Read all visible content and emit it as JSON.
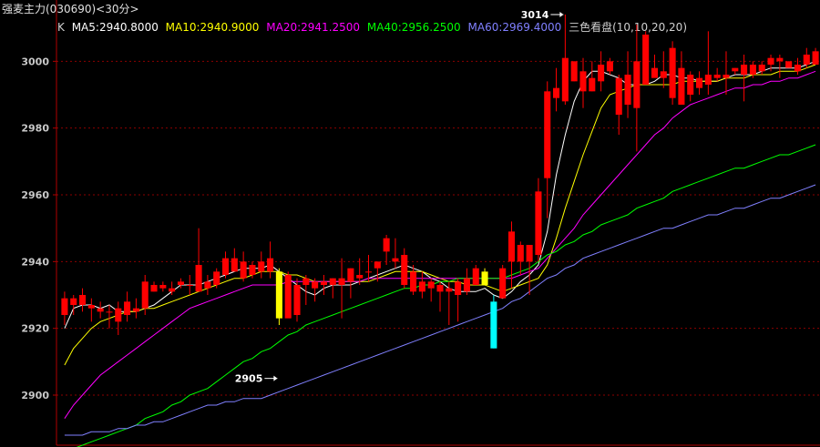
{
  "header": {
    "title": "强麦主力(030690)<30分>"
  },
  "legend": {
    "k_label": "K",
    "items": [
      {
        "text": "MA5:2940.8000",
        "color": "#ffffff"
      },
      {
        "text": "MA10:2940.9000",
        "color": "#ffff00"
      },
      {
        "text": "MA20:2941.2500",
        "color": "#ff00ff"
      },
      {
        "text": "MA40:2956.2500",
        "color": "#00ff00"
      },
      {
        "text": "MA60:2969.4000",
        "color": "#8080ff"
      },
      {
        "text": "三色看盘(10,10,20,20)",
        "color": "#d0d0d0"
      }
    ]
  },
  "colors": {
    "up": "#ff0000",
    "down_wick": "#ff0000",
    "highlight_yellow": "#ffff00",
    "highlight_cyan": "#00ffff",
    "grid": "#8b0000",
    "axis": "#b00000"
  },
  "chart_data": {
    "type": "candlestick",
    "ylim": [
      2885,
      3008
    ],
    "yticks": [
      2900,
      2920,
      2940,
      2960,
      2980,
      3000
    ],
    "candles": [
      [
        2924,
        2929,
        2921,
        2931,
        "up"
      ],
      [
        2927,
        2929,
        2924,
        2930,
        "up"
      ],
      [
        2927,
        2930,
        2925,
        2932,
        "up"
      ],
      [
        2927,
        2926,
        2922,
        2929,
        "up"
      ],
      [
        2926,
        2925,
        2923,
        2928,
        "up"
      ],
      [
        2925,
        2925,
        2920,
        2927,
        "up"
      ],
      [
        2922,
        2926,
        2918,
        2928,
        "up"
      ],
      [
        2924,
        2928,
        2922,
        2931,
        "up"
      ],
      [
        2925,
        2926,
        2923,
        2929,
        "up"
      ],
      [
        2926,
        2934,
        2924,
        2936,
        "up"
      ],
      [
        2931,
        2933,
        2931,
        2934,
        "up"
      ],
      [
        2932,
        2933,
        2931,
        2934,
        "up"
      ],
      [
        2932,
        2931,
        2930,
        2934,
        "up"
      ],
      [
        2933,
        2934,
        2932,
        2935,
        "up"
      ],
      [
        2933,
        2933,
        2930,
        2936,
        "up"
      ],
      [
        2931,
        2939,
        2931,
        2950,
        "up"
      ],
      [
        2932,
        2934,
        2930,
        2936,
        "up"
      ],
      [
        2933,
        2937,
        2932,
        2938,
        "up"
      ],
      [
        2936,
        2941,
        2935,
        2943,
        "up"
      ],
      [
        2937,
        2941,
        2937,
        2944,
        "up"
      ],
      [
        2935,
        2940,
        2934,
        2943,
        "up"
      ],
      [
        2936,
        2939,
        2935,
        2940,
        "up"
      ],
      [
        2937,
        2940,
        2935,
        2943,
        "up"
      ],
      [
        2937,
        2941,
        2935,
        2946,
        "up"
      ],
      [
        2923,
        2937,
        2921,
        2938,
        "yellow"
      ],
      [
        2923,
        2936,
        2924,
        2937,
        "up"
      ],
      [
        2924,
        2933,
        2922,
        2935,
        "up"
      ],
      [
        2933,
        2935,
        2927,
        2936,
        "up"
      ],
      [
        2932,
        2934,
        2928,
        2935,
        "up"
      ],
      [
        2933,
        2934,
        2930,
        2936,
        "up"
      ],
      [
        2933,
        2935,
        2929,
        2935,
        "up"
      ],
      [
        2933,
        2935,
        2923,
        2941,
        "up"
      ],
      [
        2934,
        2938,
        2929,
        2938,
        "up"
      ],
      [
        2935,
        2936,
        2933,
        2941,
        "up"
      ],
      [
        2937,
        2937,
        2934,
        2942,
        "up"
      ],
      [
        2938,
        2940,
        2934,
        2940,
        "up"
      ],
      [
        2943,
        2947,
        2939,
        2948,
        "up"
      ],
      [
        2940,
        2941,
        2938,
        2947,
        "up"
      ],
      [
        2933,
        2942,
        2932,
        2944,
        "up"
      ],
      [
        2931,
        2937,
        2930,
        2939,
        "up"
      ],
      [
        2931,
        2934,
        2929,
        2937,
        "up"
      ],
      [
        2932,
        2934,
        2928,
        2935,
        "up"
      ],
      [
        2931,
        2933,
        2925,
        2934,
        "up"
      ],
      [
        2931,
        2932,
        2921,
        2934,
        "up"
      ],
      [
        2930,
        2934,
        2922,
        2935,
        "up"
      ],
      [
        2931,
        2935,
        2930,
        2938,
        "up"
      ],
      [
        2933,
        2938,
        2934,
        2939,
        "up"
      ],
      [
        2933,
        2937,
        2933,
        2938,
        "yellow"
      ],
      [
        2914,
        2928,
        2914,
        2930,
        "cyan"
      ],
      [
        2929,
        2938,
        2929,
        2939,
        "up"
      ],
      [
        2940,
        2949,
        2932,
        2952,
        "up"
      ],
      [
        2940,
        2945,
        2936,
        2946,
        "up"
      ],
      [
        2940,
        2945,
        2930,
        2945,
        "up"
      ],
      [
        2942,
        2961,
        2940,
        2965,
        "up"
      ],
      [
        2965,
        2991,
        2953,
        2994,
        "up"
      ],
      [
        2989,
        2992,
        2985,
        2998,
        "up"
      ],
      [
        2988,
        3001,
        2987,
        3014,
        "up"
      ],
      [
        2994,
        3000,
        2994,
        3000,
        "up"
      ],
      [
        2991,
        2997,
        2986,
        3001,
        "up"
      ],
      [
        2991,
        2995,
        2991,
        3000,
        "up"
      ],
      [
        2994,
        2999,
        2991,
        3003,
        "up"
      ],
      [
        2997,
        3000,
        2996,
        3001,
        "up"
      ],
      [
        2984,
        2995,
        2978,
        2996,
        "up"
      ],
      [
        2987,
        2996,
        2983,
        3003,
        "up"
      ],
      [
        2986,
        3000,
        2973,
        3011,
        "up"
      ],
      [
        2993,
        3008,
        2993,
        3009,
        "up"
      ],
      [
        2995,
        2998,
        2996,
        3002,
        "up"
      ],
      [
        2995,
        2997,
        2992,
        3003,
        "up"
      ],
      [
        2989,
        3004,
        2987,
        3006,
        "up"
      ],
      [
        2987,
        2998,
        2988,
        3003,
        "up"
      ],
      [
        2990,
        2996,
        2988,
        2997,
        "up"
      ],
      [
        2992,
        2995,
        2990,
        2997,
        "up"
      ],
      [
        2993,
        2996,
        2990,
        3009,
        "up"
      ],
      [
        2995,
        2996,
        2994,
        2998,
        "up"
      ],
      [
        2995,
        2996,
        2990,
        3003,
        "up"
      ],
      [
        2997,
        2998,
        2996,
        2998,
        "up"
      ],
      [
        2996,
        2999,
        2988,
        3002,
        "up"
      ],
      [
        2996,
        2999,
        2995,
        3000,
        "up"
      ],
      [
        2997,
        2999,
        2996,
        3000,
        "up"
      ],
      [
        2999,
        3001,
        2997,
        3002,
        "up"
      ],
      [
        3000,
        3001,
        2995,
        3002,
        "up"
      ],
      [
        2998,
        3000,
        2999,
        3000,
        "up"
      ],
      [
        2997,
        2999,
        2996,
        3001,
        "up"
      ],
      [
        2999,
        3002,
        2998,
        3004,
        "up"
      ],
      [
        2999,
        3003,
        2999,
        3004,
        "up"
      ]
    ],
    "ma_lines": [
      {
        "name": "MA5",
        "color": "#ffffff",
        "values": [
          2920,
          2926,
          2927,
          2927,
          2926,
          2927,
          2925,
          2925,
          2925,
          2926,
          2927,
          2929,
          2931,
          2933,
          2933,
          2933,
          2934,
          2935,
          2936,
          2937,
          2938,
          2938,
          2938,
          2939,
          2937,
          2935,
          2933,
          2931,
          2930,
          2932,
          2933,
          2933,
          2933,
          2934,
          2935,
          2936,
          2937,
          2938,
          2939,
          2938,
          2937,
          2935,
          2934,
          2932,
          2931,
          2931,
          2931,
          2932,
          2930,
          2929,
          2931,
          2934,
          2936,
          2939,
          2949,
          2966,
          2978,
          2988,
          2994,
          2997,
          2997,
          2996,
          2995,
          2993,
          2993,
          2993,
          2994,
          2996,
          2996,
          2995,
          2995,
          2994,
          2994,
          2994,
          2995,
          2996,
          2996,
          2996,
          2997,
          2998,
          2998,
          2998,
          2998,
          2999,
          3000
        ]
      },
      {
        "name": "MA10",
        "color": "#ffff00",
        "values": [
          2909,
          2914,
          2917,
          2920,
          2922,
          2923,
          2924,
          2925,
          2925,
          2926,
          2926,
          2927,
          2928,
          2929,
          2930,
          2931,
          2932,
          2933,
          2934,
          2935,
          2935,
          2936,
          2937,
          2937,
          2937,
          2936,
          2936,
          2935,
          2934,
          2934,
          2934,
          2934,
          2934,
          2934,
          2934,
          2935,
          2936,
          2937,
          2937,
          2937,
          2937,
          2936,
          2935,
          2934,
          2934,
          2933,
          2933,
          2933,
          2932,
          2931,
          2932,
          2933,
          2934,
          2935,
          2939,
          2947,
          2956,
          2964,
          2972,
          2979,
          2986,
          2990,
          2991,
          2992,
          2993,
          2993,
          2993,
          2993,
          2993,
          2994,
          2994,
          2994,
          2994,
          2994,
          2995,
          2995,
          2995,
          2996,
          2996,
          2996,
          2997,
          2997,
          2997,
          2998,
          2999
        ]
      },
      {
        "name": "MA20",
        "color": "#ff00ff",
        "values": [
          2893,
          2897,
          2900,
          2903,
          2906,
          2908,
          2910,
          2912,
          2914,
          2916,
          2918,
          2920,
          2922,
          2924,
          2926,
          2927,
          2928,
          2929,
          2930,
          2931,
          2932,
          2933,
          2933,
          2933,
          2933,
          2934,
          2934,
          2934,
          2934,
          2934,
          2934,
          2934,
          2934,
          2934,
          2935,
          2935,
          2935,
          2935,
          2935,
          2935,
          2935,
          2935,
          2935,
          2935,
          2935,
          2935,
          2935,
          2935,
          2935,
          2935,
          2935,
          2936,
          2937,
          2938,
          2941,
          2944,
          2947,
          2950,
          2954,
          2957,
          2960,
          2963,
          2966,
          2969,
          2972,
          2975,
          2978,
          2980,
          2983,
          2985,
          2987,
          2988,
          2989,
          2990,
          2991,
          2992,
          2992,
          2993,
          2993,
          2994,
          2994,
          2995,
          2995,
          2996,
          2997
        ]
      },
      {
        "name": "MA40",
        "color": "#00ff00",
        "values": [
          2883,
          2884,
          2885,
          2886,
          2887,
          2888,
          2889,
          2890,
          2891,
          2893,
          2894,
          2895,
          2897,
          2898,
          2900,
          2901,
          2902,
          2904,
          2906,
          2908,
          2910,
          2911,
          2913,
          2914,
          2916,
          2918,
          2919,
          2921,
          2922,
          2923,
          2924,
          2925,
          2926,
          2927,
          2928,
          2929,
          2930,
          2931,
          2932,
          2932,
          2933,
          2933,
          2934,
          2934,
          2935,
          2935,
          2935,
          2935,
          2935,
          2935,
          2936,
          2937,
          2938,
          2940,
          2942,
          2943,
          2945,
          2946,
          2948,
          2949,
          2951,
          2952,
          2953,
          2954,
          2956,
          2957,
          2958,
          2959,
          2961,
          2962,
          2963,
          2964,
          2965,
          2966,
          2967,
          2968,
          2968,
          2969,
          2970,
          2971,
          2972,
          2972,
          2973,
          2974,
          2975
        ]
      },
      {
        "name": "MA60",
        "color": "#8080ff",
        "values": [
          2888,
          2888,
          2888,
          2889,
          2889,
          2889,
          2890,
          2890,
          2891,
          2891,
          2892,
          2892,
          2893,
          2894,
          2895,
          2896,
          2897,
          2897,
          2898,
          2898,
          2899,
          2899,
          2899,
          2900,
          2901,
          2902,
          2903,
          2904,
          2905,
          2906,
          2907,
          2908,
          2909,
          2910,
          2911,
          2912,
          2913,
          2914,
          2915,
          2916,
          2917,
          2918,
          2919,
          2920,
          2921,
          2922,
          2923,
          2924,
          2925,
          2926,
          2928,
          2929,
          2931,
          2933,
          2935,
          2936,
          2938,
          2939,
          2941,
          2942,
          2943,
          2944,
          2945,
          2946,
          2947,
          2948,
          2949,
          2950,
          2950,
          2951,
          2952,
          2953,
          2954,
          2954,
          2955,
          2956,
          2956,
          2957,
          2958,
          2959,
          2959,
          2960,
          2961,
          2962,
          2963
        ]
      }
    ],
    "annotations": [
      {
        "text": "3014",
        "value": 3014,
        "index": 56,
        "side": "left"
      },
      {
        "text": "2905",
        "value": 2905,
        "index": 24,
        "side": "left"
      }
    ]
  }
}
